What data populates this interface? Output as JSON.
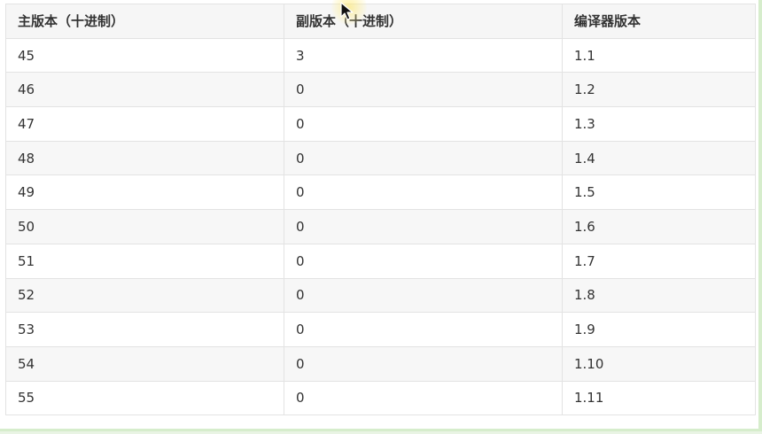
{
  "table": {
    "headers": [
      "主版本（十进制）",
      "副版本（十进制）",
      "编译器版本"
    ],
    "rows": [
      [
        "45",
        "3",
        "1.1"
      ],
      [
        "46",
        "0",
        "1.2"
      ],
      [
        "47",
        "0",
        "1.3"
      ],
      [
        "48",
        "0",
        "1.4"
      ],
      [
        "49",
        "0",
        "1.5"
      ],
      [
        "50",
        "0",
        "1.6"
      ],
      [
        "51",
        "0",
        "1.7"
      ],
      [
        "52",
        "0",
        "1.8"
      ],
      [
        "53",
        "0",
        "1.9"
      ],
      [
        "54",
        "0",
        "1.10"
      ],
      [
        "55",
        "0",
        "1.11"
      ]
    ]
  },
  "colors": {
    "header_bg": "#f6f6f6",
    "stripe_bg": "#f7f7f7",
    "border": "#e3e3e3",
    "page_accent": "#d6edcc",
    "text": "#333333"
  },
  "cursor": {
    "icon": "arrow-pointer-icon"
  }
}
